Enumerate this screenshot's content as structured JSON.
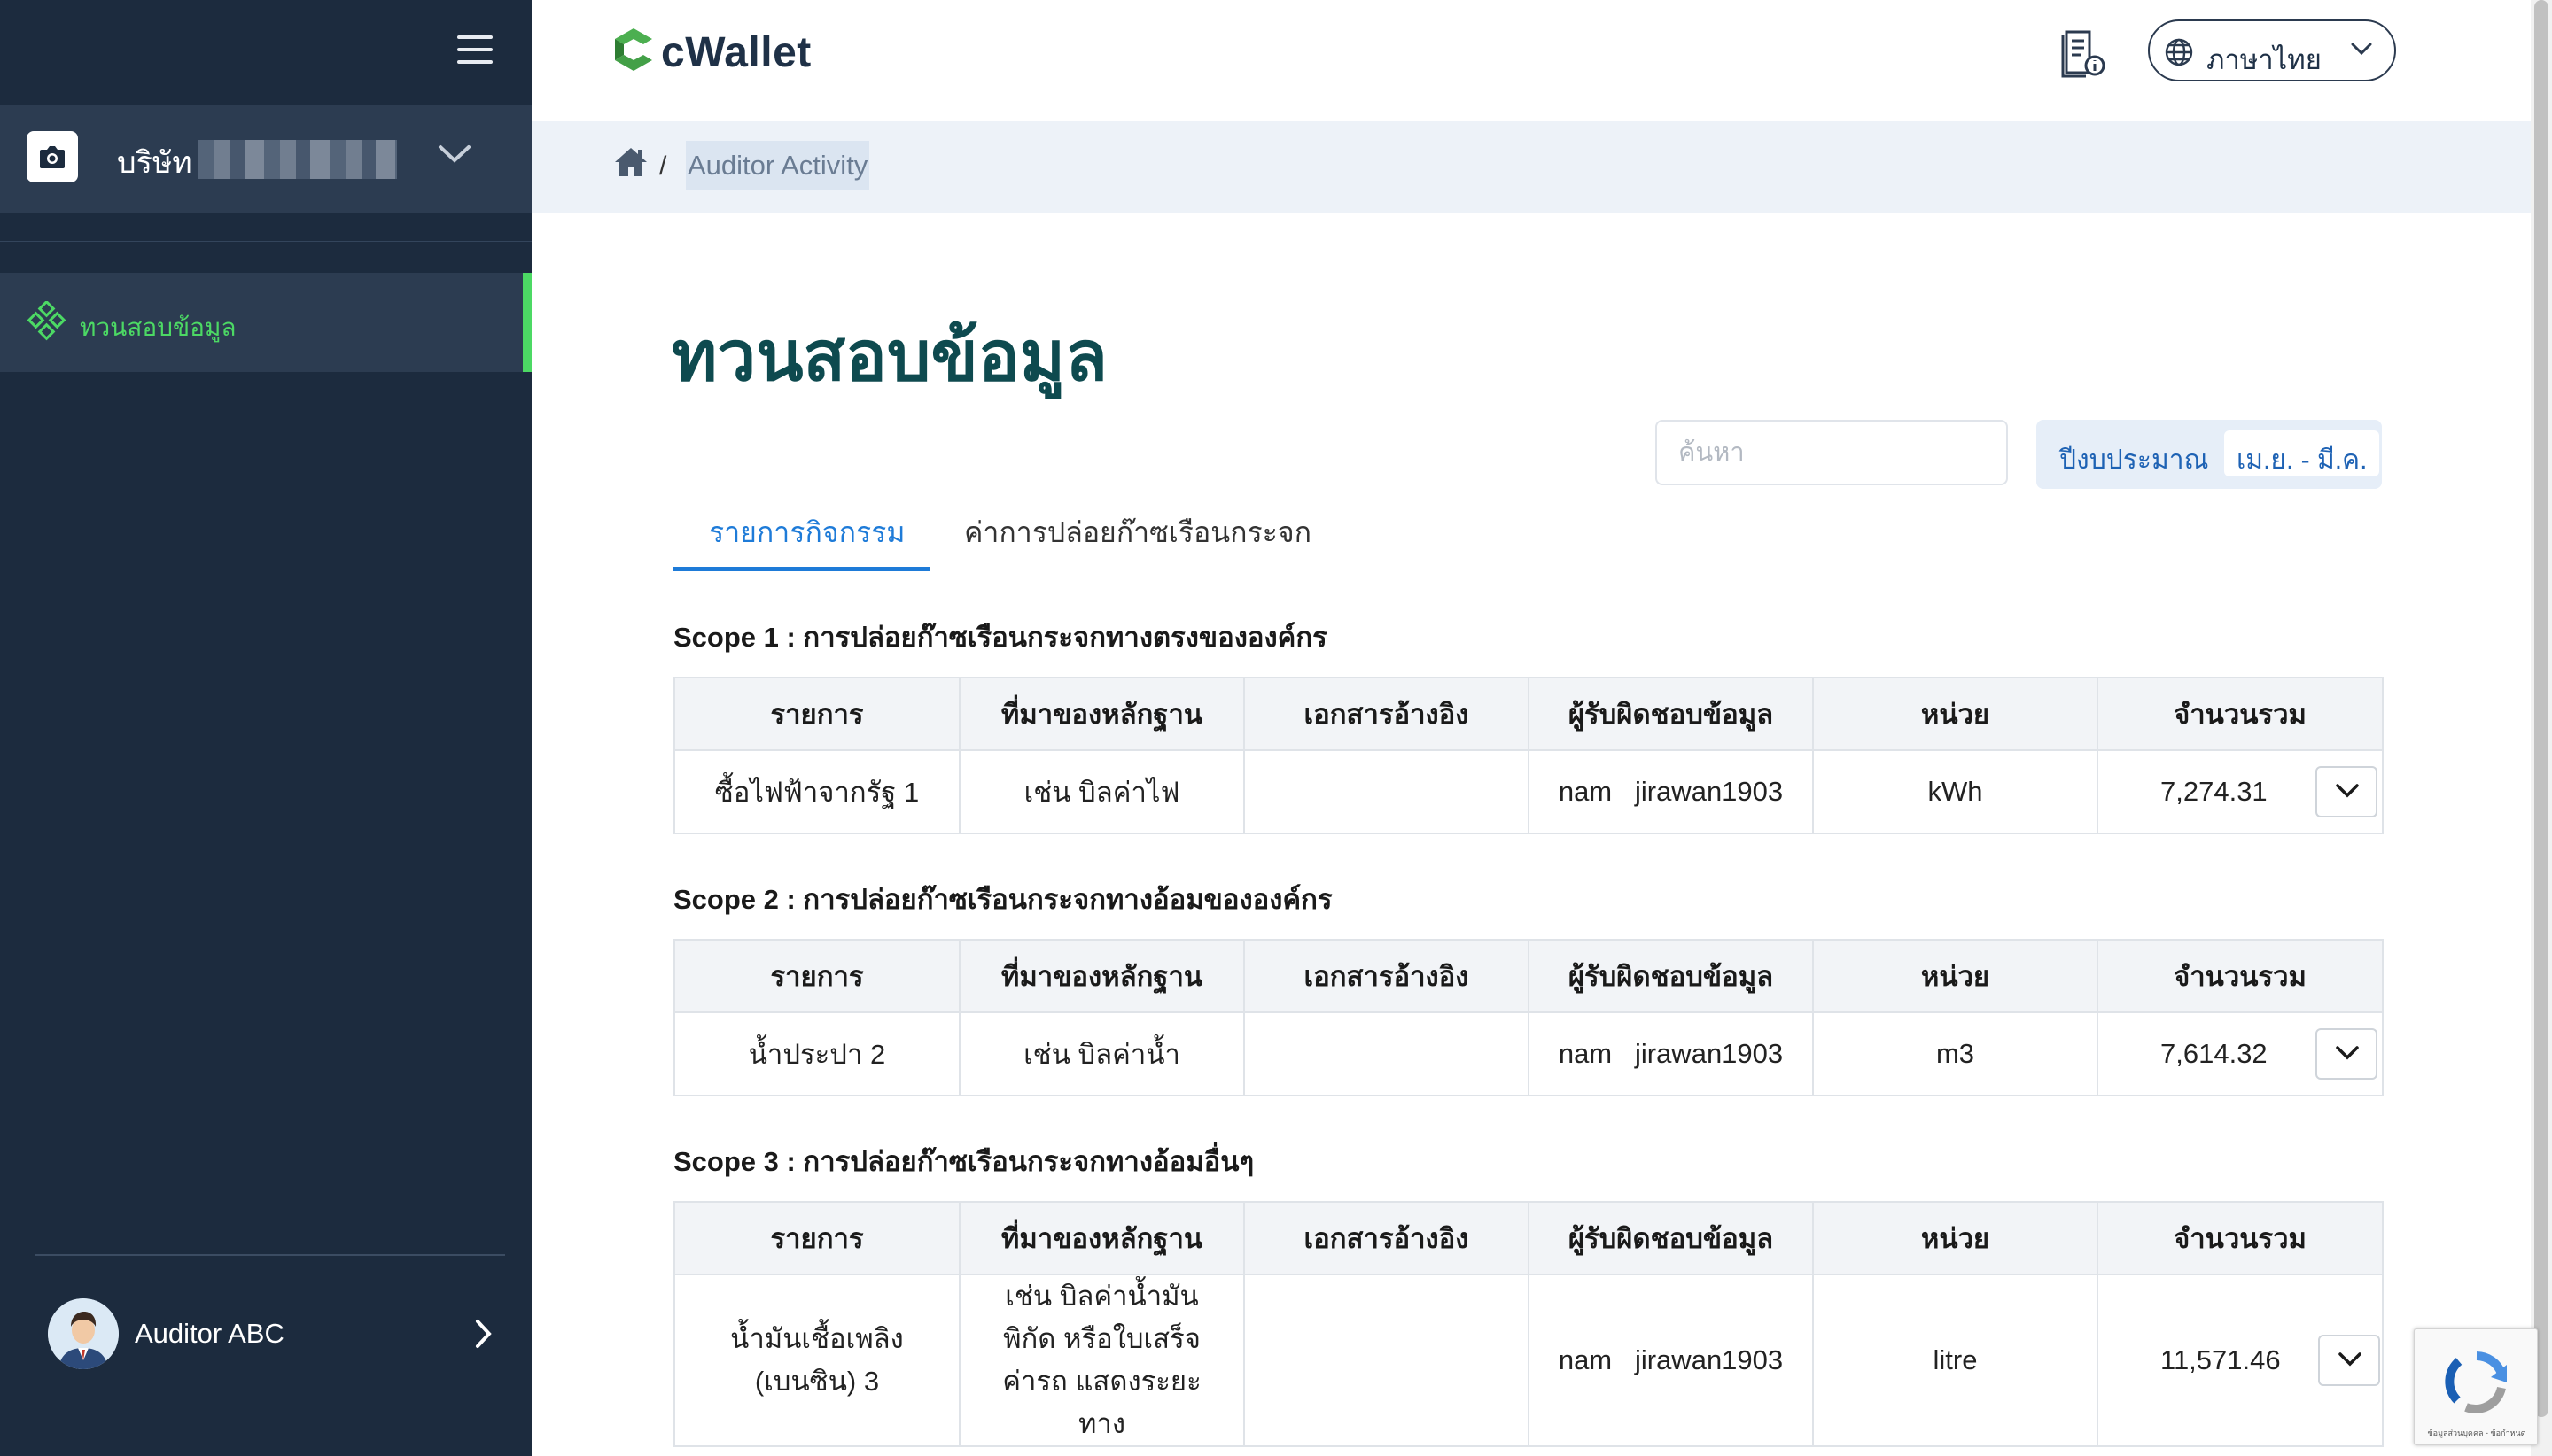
{
  "sidebar": {
    "company_name": "บริษัท",
    "nav_items": [
      {
        "label": "ทวนสอบข้อมูล"
      }
    ],
    "user": {
      "name": "Auditor ABC"
    }
  },
  "header": {
    "logo_text": "cWallet",
    "language": "ภาษาไทย",
    "breadcrumb": {
      "current": "Auditor Activity"
    }
  },
  "main": {
    "title": "ทวนสอบข้อมูล",
    "search": {
      "placeholder": "ค้นหา",
      "value": ""
    },
    "fiscal_year": {
      "label": "ปีงบประมาณ",
      "value": "เม.ย. - มี.ค."
    },
    "tabs": [
      {
        "label": "รายการกิจกรรม",
        "active": true
      },
      {
        "label": "ค่าการปล่อยก๊าซเรือนกระจก",
        "active": false
      }
    ],
    "columns": [
      "รายการ",
      "ที่มาของหลักฐาน",
      "เอกสารอ้างอิง",
      "ผู้รับผิดชอบข้อมูล",
      "หน่วย",
      "จำนวนรวม"
    ],
    "scopes": [
      {
        "title": "Scope 1 : การปล่อยก๊าซเรือนกระจกทางตรงขององค์กร",
        "rows": [
          {
            "item": "ซื้อไฟฟ้าจากรัฐ 1",
            "evidence": "เช่น บิลค่าไฟ",
            "reference": "",
            "owner": "nam   jirawan1903",
            "unit": "kWh",
            "total": "7,274.31"
          }
        ]
      },
      {
        "title": "Scope 2 : การปล่อยก๊าซเรือนกระจกทางอ้อมขององค์กร",
        "rows": [
          {
            "item": "น้ำประปา 2",
            "evidence": "เช่น บิลค่าน้ำ",
            "reference": "",
            "owner": "nam   jirawan1903",
            "unit": "m3",
            "total": "7,614.32"
          }
        ]
      },
      {
        "title": "Scope 3 : การปล่อยก๊าซเรือนกระจกทางอ้อมอื่นๆ",
        "rows": [
          {
            "item": "น้ำมันเชื้อเพลิง (เบนซิน) 3",
            "evidence": "เช่น บิลค่าน้ำมัน พิกัด หรือใบเสร็จค่ารถ แสดงระยะทาง",
            "reference": "",
            "owner": "nam   jirawan1903",
            "unit": "litre",
            "total": "11,571.46"
          }
        ]
      }
    ]
  },
  "recaptcha": {
    "text": "ข้อมูลส่วนบุคคล - ข้อกำหนด"
  },
  "colors": {
    "sidebar_bg": "#1c2b3e",
    "accent_green": "#4cd964",
    "title_teal": "#0e4a4f",
    "link_blue": "#1e7bd8"
  }
}
